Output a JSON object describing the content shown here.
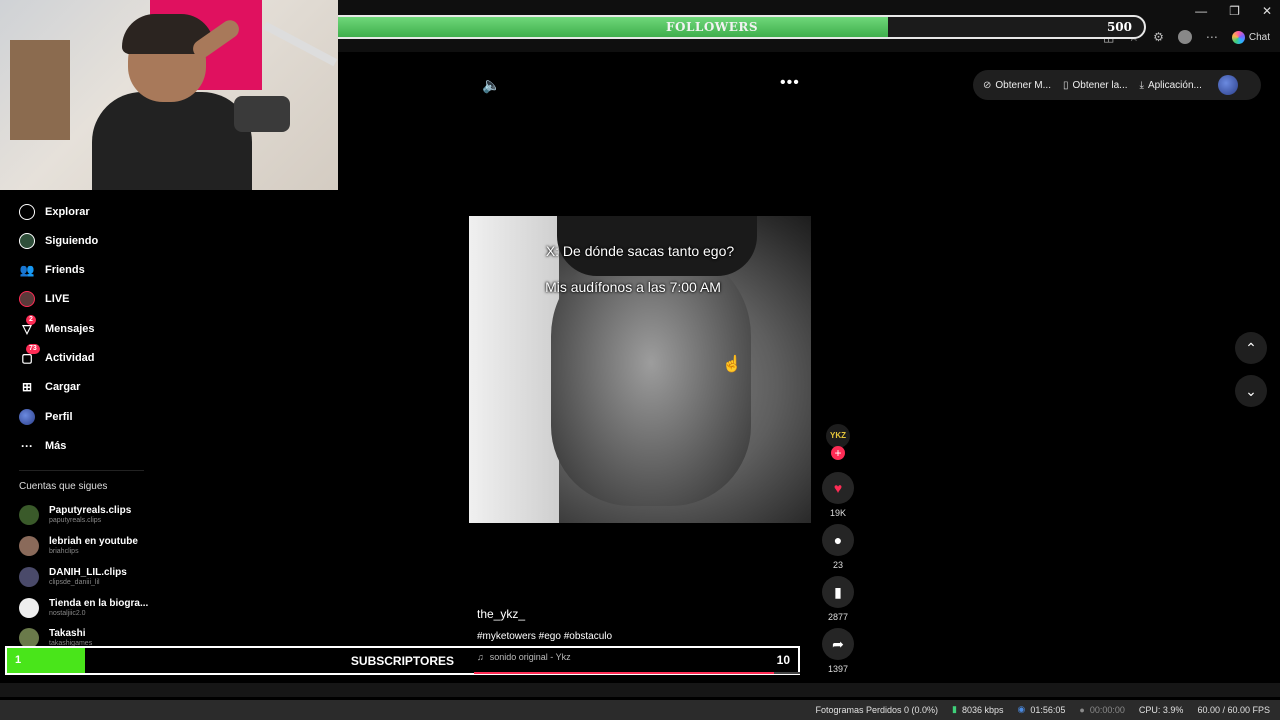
{
  "followers_goal": {
    "current": "352",
    "label": "FOLLOWERS",
    "target": "500",
    "progress": 0.704
  },
  "browser": {
    "chat_label": "Chat",
    "action_buttons": [
      {
        "icon": "link-icon",
        "label": "Obtener M..."
      },
      {
        "icon": "phone-icon",
        "label": "Obtener la..."
      },
      {
        "icon": "download-icon",
        "label": "Aplicación..."
      }
    ]
  },
  "sidebar": {
    "nav": [
      {
        "label": "Explorar",
        "icon": "compass-icon"
      },
      {
        "label": "Siguiendo",
        "icon": "following-avatar-icon"
      },
      {
        "label": "Friends",
        "icon": "friends-icon"
      },
      {
        "label": "LIVE",
        "icon": "live-icon"
      },
      {
        "label": "Mensajes",
        "icon": "messages-icon",
        "badge": "2"
      },
      {
        "label": "Actividad",
        "icon": "activity-icon",
        "badge": "73"
      },
      {
        "label": "Cargar",
        "icon": "upload-icon"
      },
      {
        "label": "Perfil",
        "icon": "profile-icon"
      },
      {
        "label": "Más",
        "icon": "more-icon"
      }
    ],
    "following_title": "Cuentas que sigues",
    "accounts": [
      {
        "name": "Paputyreals.clips",
        "handle": "paputyreals.clips",
        "color": "#3a5a2a"
      },
      {
        "name": "lebriah en youtube",
        "handle": "briahclips",
        "color": "#8a6a5a"
      },
      {
        "name": "DANIH_LIL.clips",
        "handle": "clipsde_daniii_lil",
        "color": "#4a4a6a"
      },
      {
        "name": "Tienda en la biogra...",
        "handle": "nostaljiic2.0",
        "color": "#eeeeee"
      },
      {
        "name": "Takashi",
        "handle": "takashigames",
        "color": "#6a7a4a"
      }
    ]
  },
  "video": {
    "caption_line1": "X: De dónde sacas tanto ego?",
    "caption_line2": "Mis audífonos a las 7:00 AM",
    "username": "the_ykz_",
    "hashtags": "#myketowers #ego #obstaculo",
    "sound": "sonido original - Ykz",
    "progress": 0.92,
    "author_badge": "YKZ"
  },
  "actions": {
    "likes": "19K",
    "comments": "23",
    "saves": "2877",
    "shares": "1397"
  },
  "subscribers_goal": {
    "current": "1",
    "label": "SUBSCRIPTORES",
    "target": "10"
  },
  "status": {
    "dropped": "Fotogramas Perdidos 0 (0.0%)",
    "bitrate": "8036 kbps",
    "stream_time": "01:56:05",
    "rec_time": "00:00:00",
    "cpu": "CPU: 3.9%",
    "fps": "60.00 / 60.00 FPS"
  },
  "colors": {
    "accent": "#fe2c55",
    "follower_bar": "#4fc35c",
    "subs_fill": "#49e51a"
  }
}
